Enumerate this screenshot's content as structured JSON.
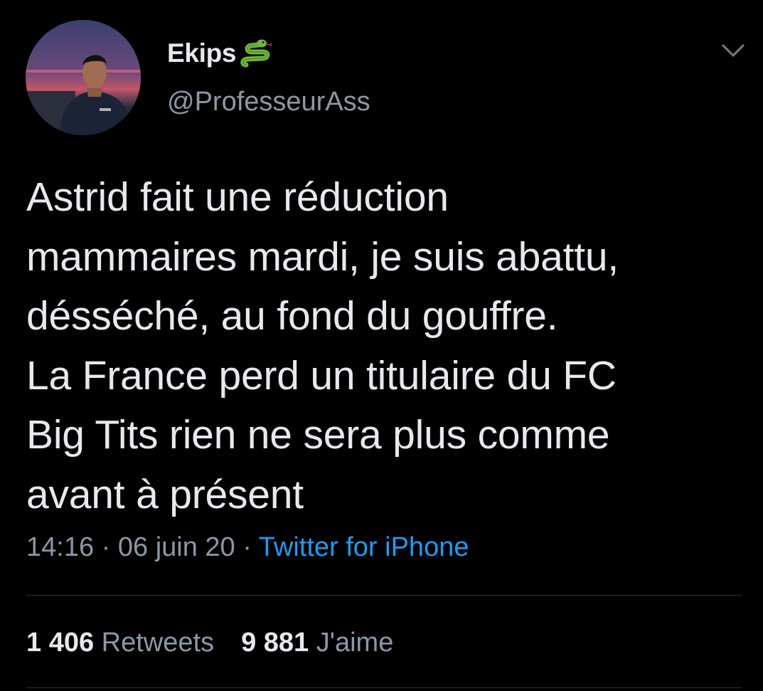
{
  "user": {
    "display_name": "Ekips",
    "badge_emoji": "snake-emoji",
    "handle": "@ProfesseurAss",
    "avatar": "avatar-photo"
  },
  "tweet": {
    "text": "Astrid fait une réduction\nmammaires mardi, je suis abattu,\ndésséché, au fond du gouffre.\nLa France perd un titulaire du FC\nBig Tits rien ne sera plus comme\navant à présent",
    "time": "14:16",
    "separator": "·",
    "date": "06 juin 20",
    "source": "Twitter for iPhone"
  },
  "stats": {
    "retweets_count": "1 406",
    "retweets_label": "Retweets",
    "likes_count": "9 881",
    "likes_label": "J'aime"
  },
  "colors": {
    "background": "#000000",
    "text": "#e7e9ea",
    "secondary": "#8b98a5",
    "link": "#1d9bf0",
    "divider": "#2f3336"
  },
  "icons": {
    "menu": "chevron-down-icon"
  }
}
